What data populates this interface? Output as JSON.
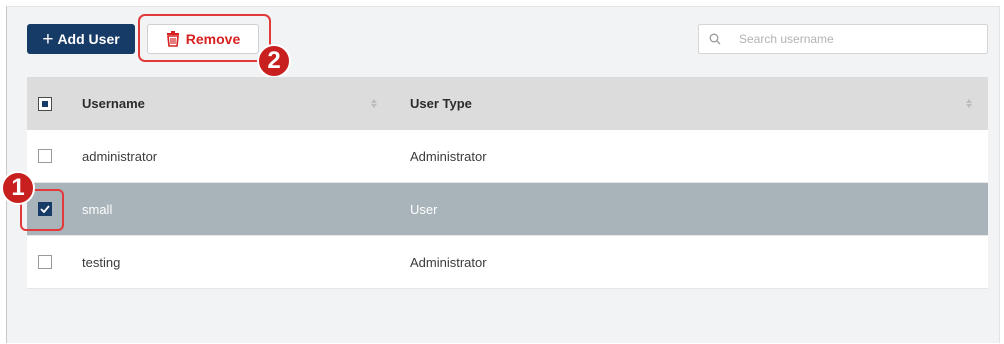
{
  "toolbar": {
    "add_user_label": "Add User",
    "add_user_icon": "plus-icon",
    "remove_label": "Remove",
    "remove_icon": "trash-icon",
    "remove_color": "#d72020",
    "add_user_color": "#163b67"
  },
  "search": {
    "placeholder": "Search username",
    "value": "",
    "icon": "search-icon"
  },
  "table": {
    "columns": [
      "Username",
      "User Type"
    ],
    "header_checkbox_state": "indeterminate",
    "rows": [
      {
        "username": "administrator",
        "user_type": "Administrator",
        "checked": false,
        "selected": false
      },
      {
        "username": "small",
        "user_type": "User",
        "checked": true,
        "selected": true
      },
      {
        "username": "testing",
        "user_type": "Administrator",
        "checked": false,
        "selected": false
      }
    ]
  },
  "annotations": {
    "step1": "1",
    "step2": "2",
    "highlight_color": "#e23a3a"
  }
}
